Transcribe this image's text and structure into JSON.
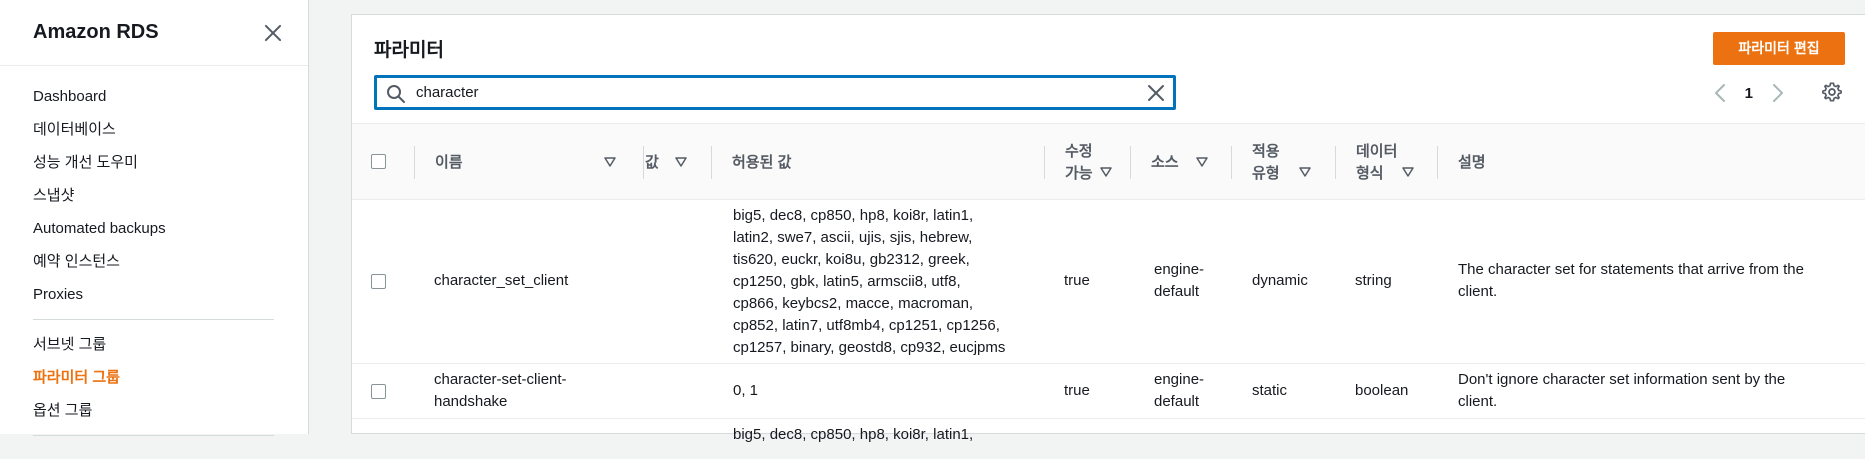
{
  "sidebar": {
    "title": "Amazon RDS",
    "close_icon": "close-icon",
    "items": [
      {
        "label": "Dashboard"
      },
      {
        "label": "데이터베이스"
      },
      {
        "label": "성능 개선 도우미"
      },
      {
        "label": "스냅샷"
      },
      {
        "label": "Automated backups"
      },
      {
        "label": "예약 인스턴스"
      },
      {
        "label": "Proxies"
      }
    ],
    "items2": [
      {
        "label": "서브넷 그룹"
      },
      {
        "label": "파라미터 그룹",
        "active": true
      },
      {
        "label": "옵션 그룹"
      }
    ],
    "accent_color": "#ec7211"
  },
  "panel": {
    "title": "파라미터",
    "edit_button": "파라미터 편집",
    "search": {
      "value": "character",
      "icon": "search-icon",
      "clear_icon": "close-icon"
    },
    "pagination": {
      "page": "1",
      "prev_icon": "chevron-left-icon",
      "next_icon": "chevron-right-icon"
    },
    "settings_icon": "gear-icon"
  },
  "table": {
    "columns": [
      {
        "key": "name",
        "label": "이름"
      },
      {
        "key": "value",
        "label": "값"
      },
      {
        "key": "allowed",
        "label": "허용된 값"
      },
      {
        "key": "modifiable",
        "label1": "수정",
        "label2": "가능"
      },
      {
        "key": "source",
        "label": "소스"
      },
      {
        "key": "apply_type",
        "label1": "적용",
        "label2": "유형"
      },
      {
        "key": "data_type",
        "label1": "데이터",
        "label2": "형식"
      },
      {
        "key": "description",
        "label": "설명"
      }
    ],
    "rows": [
      {
        "name_lines": [
          "character_set_client"
        ],
        "value": "",
        "allowed_lines": [
          "big5, dec8, cp850, hp8, koi8r, latin1,",
          "latin2, swe7, ascii, ujis, sjis, hebrew,",
          "tis620, euckr, koi8u, gb2312, greek,",
          "cp1250, gbk, latin5, armscii8, utf8,",
          "cp866, keybcs2, macce, macroman,",
          "cp852, latin7, utf8mb4, cp1251, cp1256,",
          "cp1257, binary, geostd8, cp932, eucjpms"
        ],
        "modifiable": "true",
        "source_lines": [
          "engine-",
          "default"
        ],
        "apply_type": "dynamic",
        "data_type": "string",
        "description_lines": [
          "The character set for statements that arrive from the",
          "client."
        ]
      },
      {
        "name_lines": [
          "character-set-client-",
          "handshake"
        ],
        "value": "",
        "allowed_lines": [
          "0, 1"
        ],
        "modifiable": "true",
        "source_lines": [
          "engine-",
          "default"
        ],
        "apply_type": "static",
        "data_type": "boolean",
        "description_lines": [
          "Don't ignore character set information sent by the",
          "client."
        ]
      },
      {
        "allowed_lines": [
          "big5, dec8, cp850, hp8, koi8r, latin1,"
        ]
      }
    ]
  }
}
